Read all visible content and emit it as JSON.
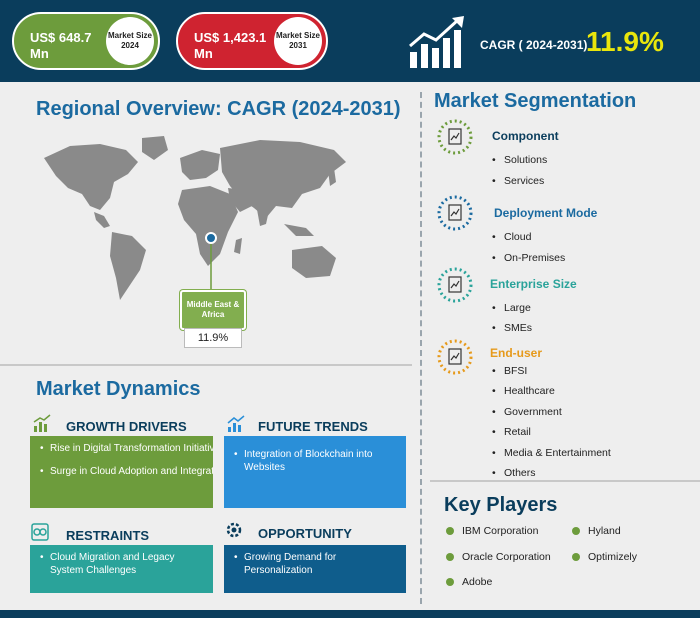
{
  "header": {
    "size_2024": {
      "value": "US$ 648.7 Mn",
      "label": "Market Size 2024",
      "color": "#6d9c3c"
    },
    "size_2031": {
      "value": "US$ 1,423.1 Mn",
      "label": "Market Size 2031",
      "color": "#cf2330"
    },
    "cagr_label": "CAGR ( 2024-2031)",
    "cagr_value": "11.9%",
    "icon": "growth-chart-icon"
  },
  "regional": {
    "title": "Regional Overview: CAGR (2024-2031)",
    "region_name": "Middle East & Africa",
    "region_cagr": "11.9%"
  },
  "dynamics": {
    "title": "Market Dynamics",
    "growth_drivers": {
      "title": "GROWTH DRIVERS",
      "icon": "bar-chart-icon",
      "color": "#6d9c3c",
      "items": [
        "Rise in Digital Transformation Initiatives",
        "Surge in Cloud Adoption and Integration"
      ]
    },
    "future_trends": {
      "title": "FUTURE TRENDS",
      "icon": "trend-chart-icon",
      "color": "#2a8fd8",
      "items": [
        "Integration of Blockchain into Websites"
      ]
    },
    "restraints": {
      "title": "RESTRAINTS",
      "icon": "broken-link-icon",
      "color": "#2aa39a",
      "items": [
        "Cloud Migration and Legacy System Challenges"
      ]
    },
    "opportunity": {
      "title": "OPPORTUNITY",
      "icon": "gear-icon",
      "color": "#0f5d8c",
      "items": [
        "Growing Demand for Personalization"
      ]
    }
  },
  "segmentation": {
    "title": "Market Segmentation",
    "groups": [
      {
        "name": "Component",
        "color": "#0a3d5c",
        "ring": "#6d9c3c",
        "items": [
          "Solutions",
          "Services"
        ]
      },
      {
        "name": "Deployment Mode",
        "color": "#1b6aa0",
        "ring": "#1b6aa0",
        "items": [
          "Cloud",
          "On-Premises"
        ]
      },
      {
        "name": "Enterprise Size",
        "color": "#2aa39a",
        "ring": "#2aa39a",
        "items": [
          "Large",
          "SMEs"
        ]
      },
      {
        "name": "End-user",
        "color": "#e69a1c",
        "ring": "#e69a1c",
        "items": [
          "BFSI",
          "Healthcare",
          "Government",
          "Retail",
          "Media & Entertainment",
          "Others"
        ]
      }
    ]
  },
  "key_players": {
    "title": "Key Players",
    "items": [
      "IBM Corporation",
      "Hyland",
      "Oracle Corporation",
      "Optimizely",
      "Adobe"
    ]
  }
}
